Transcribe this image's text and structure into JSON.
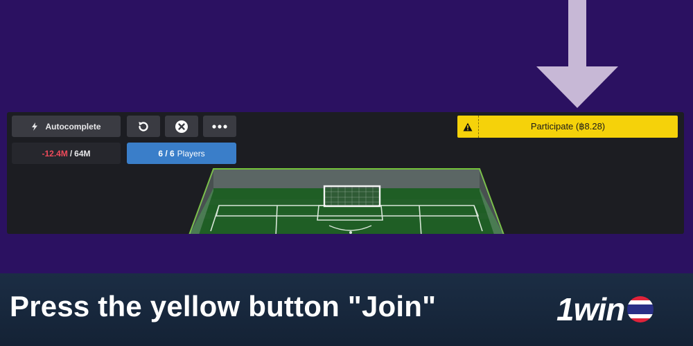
{
  "toolbar": {
    "autocomplete_label": "Autocomplete",
    "refresh_icon": "refresh-icon",
    "cancel_icon": "close-circle-icon",
    "more_icon": "more-dots-icon"
  },
  "balance": {
    "current": "-12.4M",
    "separator": "/",
    "max": "64M"
  },
  "players": {
    "count": "6 / 6",
    "label": "Players"
  },
  "participate": {
    "label": "Participate",
    "amount": "(฿8.28)",
    "warning_icon": "warning-icon"
  },
  "caption": {
    "text": "Press the yellow button \"Join\""
  },
  "logo": {
    "text": "1win"
  },
  "colors": {
    "background": "#2b1161",
    "panel": "#1c1d22",
    "accent_yellow": "#f5d20a",
    "players_blue": "#3a7ec9",
    "negative_red": "#ef4a5a",
    "caption_bar": "#1b2d44"
  }
}
